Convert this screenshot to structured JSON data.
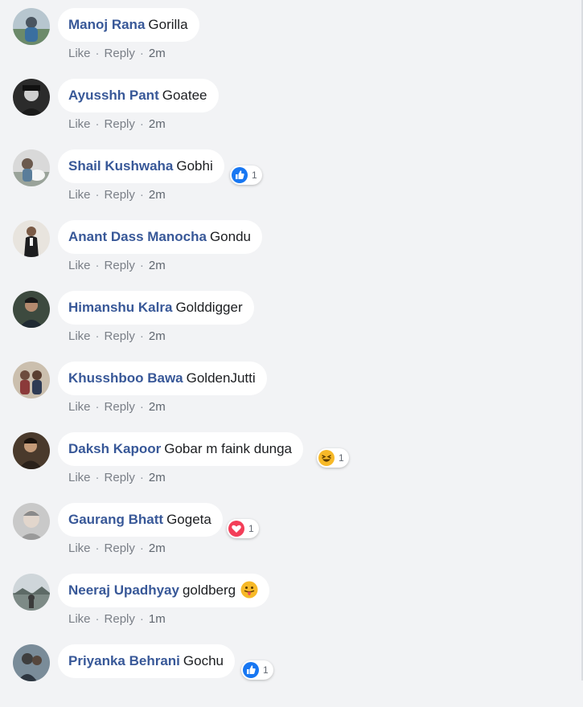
{
  "action_labels": {
    "like": "Like",
    "reply": "Reply",
    "separator": "·"
  },
  "comments": [
    {
      "author": "Manoj Rana",
      "text": "Gorilla",
      "time": "2m"
    },
    {
      "author": "Ayusshh Pant",
      "text": "Goatee",
      "time": "2m"
    },
    {
      "author": "Shail Kushwaha",
      "text": "Gobhi",
      "time": "2m",
      "reaction": {
        "icon": "like-reaction-icon",
        "count": "1",
        "color": "#1877f2"
      }
    },
    {
      "author": "Anant Dass Manocha",
      "text": "Gondu",
      "time": "2m"
    },
    {
      "author": "Himanshu Kalra",
      "text": "Golddigger",
      "time": "2m"
    },
    {
      "author": "Khusshboo Bawa",
      "text": "GoldenJutti",
      "time": "2m"
    },
    {
      "author": "Daksh Kapoor",
      "text": "Gobar m faink dunga",
      "time": "2m",
      "reaction": {
        "icon": "haha-reaction-icon",
        "count": "1",
        "color": "#f7b928"
      }
    },
    {
      "author": "Gaurang Bhatt",
      "text": "Gogeta",
      "time": "2m",
      "reaction": {
        "icon": "love-reaction-icon",
        "count": "1",
        "color": "#f33e58"
      }
    },
    {
      "author": "Neeraj Upadhyay",
      "text": "goldberg",
      "time": "1m",
      "inline_emoji": "tongue-out-emoji-icon"
    },
    {
      "author": "Priyanka Behrani",
      "text": "Gochu",
      "time": "",
      "reaction": {
        "icon": "like-reaction-icon",
        "count": "1",
        "color": "#1877f2"
      }
    }
  ],
  "colors": {
    "author": "#385898",
    "background": "#f2f3f5",
    "bubble": "#ffffff",
    "meta": "#606770"
  }
}
